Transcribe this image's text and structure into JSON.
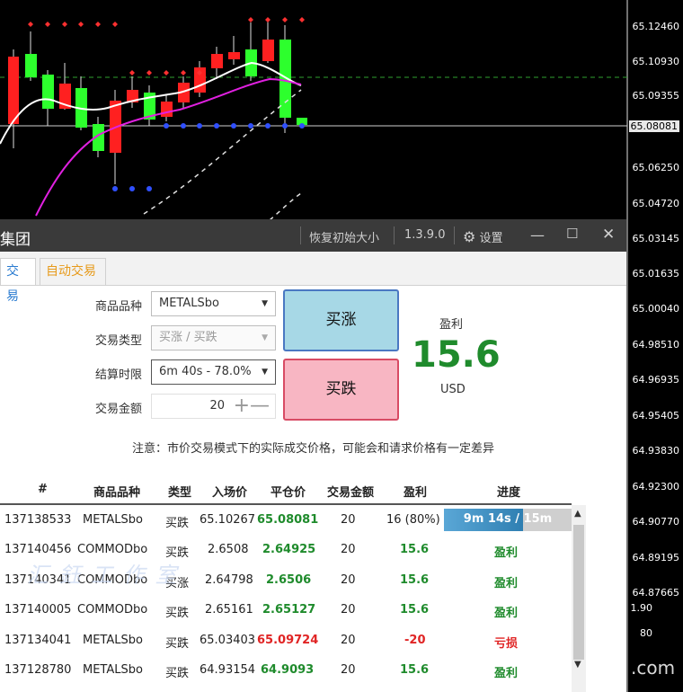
{
  "chart": {
    "price_labels": [
      "65.12460",
      "65.10930",
      "65.09355",
      "65.08081",
      "65.06250",
      "65.04720",
      "65.03145",
      "65.01635",
      "65.00040",
      "64.98510",
      "64.96935",
      "64.95405",
      "64.93830",
      "64.92300",
      "64.90770",
      "64.89195",
      "64.87665",
      "1.90",
      "80"
    ],
    "current_price": "65.08081",
    "watermark_suffix": ".com"
  },
  "panel": {
    "title": "集团",
    "title_buttons": {
      "restore": "恢复初始大小",
      "version": "1.3.9.0",
      "settings": "设置"
    },
    "tabs": {
      "trade": "交易",
      "auto_trade": "自动交易"
    },
    "form": {
      "product_label": "商品品种",
      "product_value": "METALSbo",
      "type_label": "交易类型",
      "type_value": "买涨 / 买跌",
      "expiry_label": "结算时限",
      "expiry_value": "6m 40s - 78.0%",
      "amount_label": "交易金额",
      "amount_value": "20"
    },
    "buttons": {
      "rise": "买涨",
      "fall": "买跌"
    },
    "profit": {
      "label": "盈利",
      "value": "15.6",
      "currency": "USD"
    },
    "notice": "注意：市价交易模式下的实际成交价格，可能会和请求价格有一定差异",
    "table": {
      "headers": [
        "#",
        "商品品种",
        "类型",
        "入场价",
        "平仓价",
        "交易金额",
        "盈利",
        "进度"
      ],
      "rows": [
        {
          "id": "137138533",
          "product": "METALSbo",
          "type": "买跌",
          "entry": "65.10267",
          "close": "65.08081",
          "amount": "20",
          "profit": "16 (80%)",
          "progress_text": "9m 14s / 15m",
          "progress_fraction": 0.62
        },
        {
          "id": "137140456",
          "product": "COMMODbo",
          "type": "买跌",
          "entry": "2.6508",
          "close": "2.64925",
          "amount": "20",
          "profit": "15.6",
          "status": "盈利"
        },
        {
          "id": "137140341",
          "product": "COMMODbo",
          "type": "买涨",
          "entry": "2.64798",
          "close": "2.6506",
          "amount": "20",
          "profit": "15.6",
          "status": "盈利"
        },
        {
          "id": "137140005",
          "product": "COMMODbo",
          "type": "买跌",
          "entry": "2.65161",
          "close": "2.65127",
          "amount": "20",
          "profit": "15.6",
          "status": "盈利"
        },
        {
          "id": "137134041",
          "product": "METALSbo",
          "type": "买跌",
          "entry": "65.03403",
          "close": "65.09724",
          "amount": "20",
          "profit": "-20",
          "status": "亏损"
        },
        {
          "id": "137128780",
          "product": "METALSbo",
          "type": "买跌",
          "entry": "64.93154",
          "close": "64.9093",
          "amount": "20",
          "profit": "15.6",
          "status": "盈利"
        }
      ]
    },
    "watermark": "汇 鈺 工 作 室"
  },
  "colors": {
    "profit_green": "#1f8b2c",
    "loss_red": "#e02424",
    "rise_button": "#a7d8e6",
    "fall_button": "#f8b6c3"
  }
}
